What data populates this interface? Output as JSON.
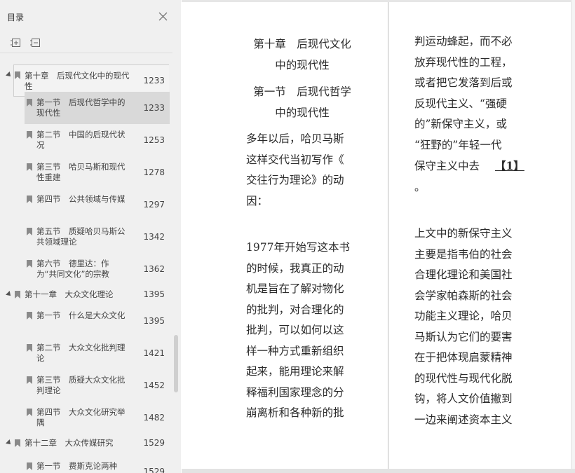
{
  "sidebar": {
    "title": "目录",
    "toc": [
      {
        "label": "第十章　后现代文化中的现代性",
        "page": "1233",
        "level": 1
      },
      {
        "label": "第一节　后现代哲学中的现代性",
        "page": "1233",
        "level": 2
      },
      {
        "label": "第二节　中国的后现代状况",
        "page": "1253",
        "level": 2
      },
      {
        "label": "第三节　哈贝马斯和现代性重建",
        "page": "1278",
        "level": 2
      },
      {
        "label": "第四节　公共领域与传媒",
        "page": "1297",
        "level": 2
      },
      {
        "label": "第五节　质疑哈贝马斯公共领域理论",
        "page": "1342",
        "level": 2
      },
      {
        "label": "第六节　德里达：作为“共同文化”的宗教",
        "page": "1362",
        "level": 2
      },
      {
        "label": "第十一章　大众文化理论",
        "page": "1395",
        "level": 1
      },
      {
        "label": "第一节　什么是大众文化",
        "page": "1395",
        "level": 2
      },
      {
        "label": "第二节　大众文化批判理论",
        "page": "1421",
        "level": 2
      },
      {
        "label": "第三节　质疑大众文化批判理论",
        "page": "1452",
        "level": 2
      },
      {
        "label": "第四节　大众文化研究举隅",
        "page": "1482",
        "level": 2
      },
      {
        "label": "第十二章　大众传媒研究",
        "page": "1529",
        "level": 1
      },
      {
        "label": "第一节　费斯克论两种",
        "page": "1529",
        "level": 2
      }
    ]
  },
  "document": {
    "left": {
      "heading1": [
        "第十章　后现代文化",
        "中的现代性"
      ],
      "heading2": [
        "第一节　后现代哲学",
        "中的现代性"
      ],
      "para1": [
        "多年以后，哈贝马斯",
        "这样交代当初写作《",
        "交往行为理论》的动",
        "因："
      ],
      "para2": [
        "1977年开始写这本书",
        "的时候，我真正的动",
        "机是旨在了解对物化",
        "的批判，对合理化的",
        "批判，可以如何以这",
        "样一种方式重新组织",
        "起来，能用理论来解",
        "释福利国家理念的分",
        "崩离析和各种新的批"
      ]
    },
    "right": {
      "para1": [
        "判运动蜂起，而不必",
        "放弃现代性的工程，",
        "或者把它发落到后或",
        "反现代主义、“强硬",
        "的”新保守主义，或",
        "“狂野的”年轻一代",
        "保守主义中去"
      ],
      "footnote": "【1】",
      "para1_tail": "。",
      "para2": [
        "上文中的新保守主义",
        "主要是指韦伯的社会",
        "合理化理论和美国社",
        "会学家帕森斯的社会",
        "功能主义理论，哈贝",
        "马斯认为它们的要害",
        "在于把体现启蒙精神",
        "的现代性与现代化脱",
        "钩，将人文价值撇到",
        "一边来阐述资本主义"
      ]
    }
  }
}
